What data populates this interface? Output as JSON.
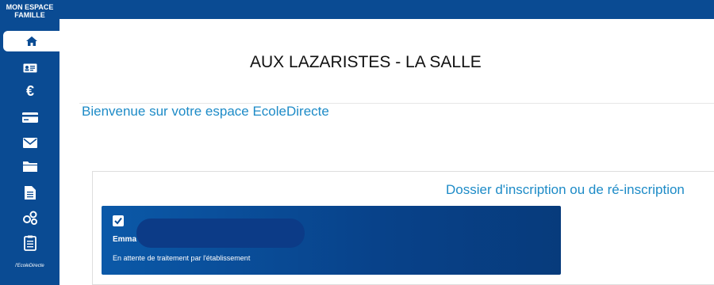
{
  "sidebar": {
    "brand": "MON ESPACE FAMILLE",
    "brand_small": "l'EcoleDirecte",
    "items": [
      {
        "icon": "home-icon"
      },
      {
        "icon": "id-card-icon"
      },
      {
        "icon": "euro-icon"
      },
      {
        "icon": "credit-card-icon"
      },
      {
        "icon": "mail-icon"
      },
      {
        "icon": "folder-icon"
      },
      {
        "icon": "document-icon"
      },
      {
        "icon": "people-icon"
      },
      {
        "icon": "clipboard-icon"
      }
    ]
  },
  "main": {
    "school_name": "AUX LAZARISTES - LA SALLE",
    "welcome": "Bienvenue sur votre espace EcoleDirecte",
    "panel_title": "Dossier d'inscription ou de ré-inscription",
    "card": {
      "student_name": "Emma",
      "status": "En attente de traitement par l'établissement"
    }
  },
  "colors": {
    "sidebar_bg": "#0a4b93",
    "accent": "#1d8bc7",
    "card_bg": "#08428a"
  }
}
